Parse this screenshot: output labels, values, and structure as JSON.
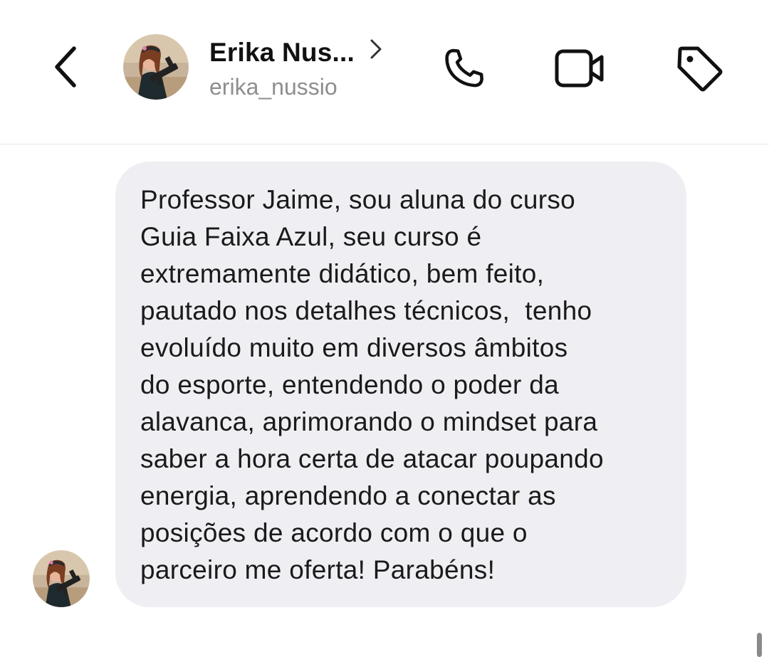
{
  "header": {
    "back_icon": "back-chevron-icon",
    "contact_name": "Erika Nus...",
    "username": "erika_nussio",
    "profile_chevron_icon": "chevron-right-icon",
    "actions": [
      {
        "name": "phone",
        "icon": "phone-icon"
      },
      {
        "name": "video",
        "icon": "video-camera-icon"
      },
      {
        "name": "tag",
        "icon": "tag-icon"
      }
    ]
  },
  "message": {
    "lines": [
      "Professor Jaime, sou aluna do curso",
      "Guia Faixa Azul, seu curso é",
      "extremamente didático, bem feito,",
      "pautado nos detalhes técnicos,  tenho",
      "evoluído muito em diversos âmbitos",
      "do esporte, entendendo o poder da",
      "alavanca, aprimorando o mindset para",
      "saber a hora certa de atacar poupando",
      "energia, aprendendo a conectar as",
      "posições de acordo com o que o",
      "parceiro me oferta! Parabéns!"
    ]
  },
  "colors": {
    "bubble_bg": "#efeff3",
    "text": "#111111",
    "secondary_text": "#8e8e8e",
    "divider": "#e6e6e6"
  }
}
